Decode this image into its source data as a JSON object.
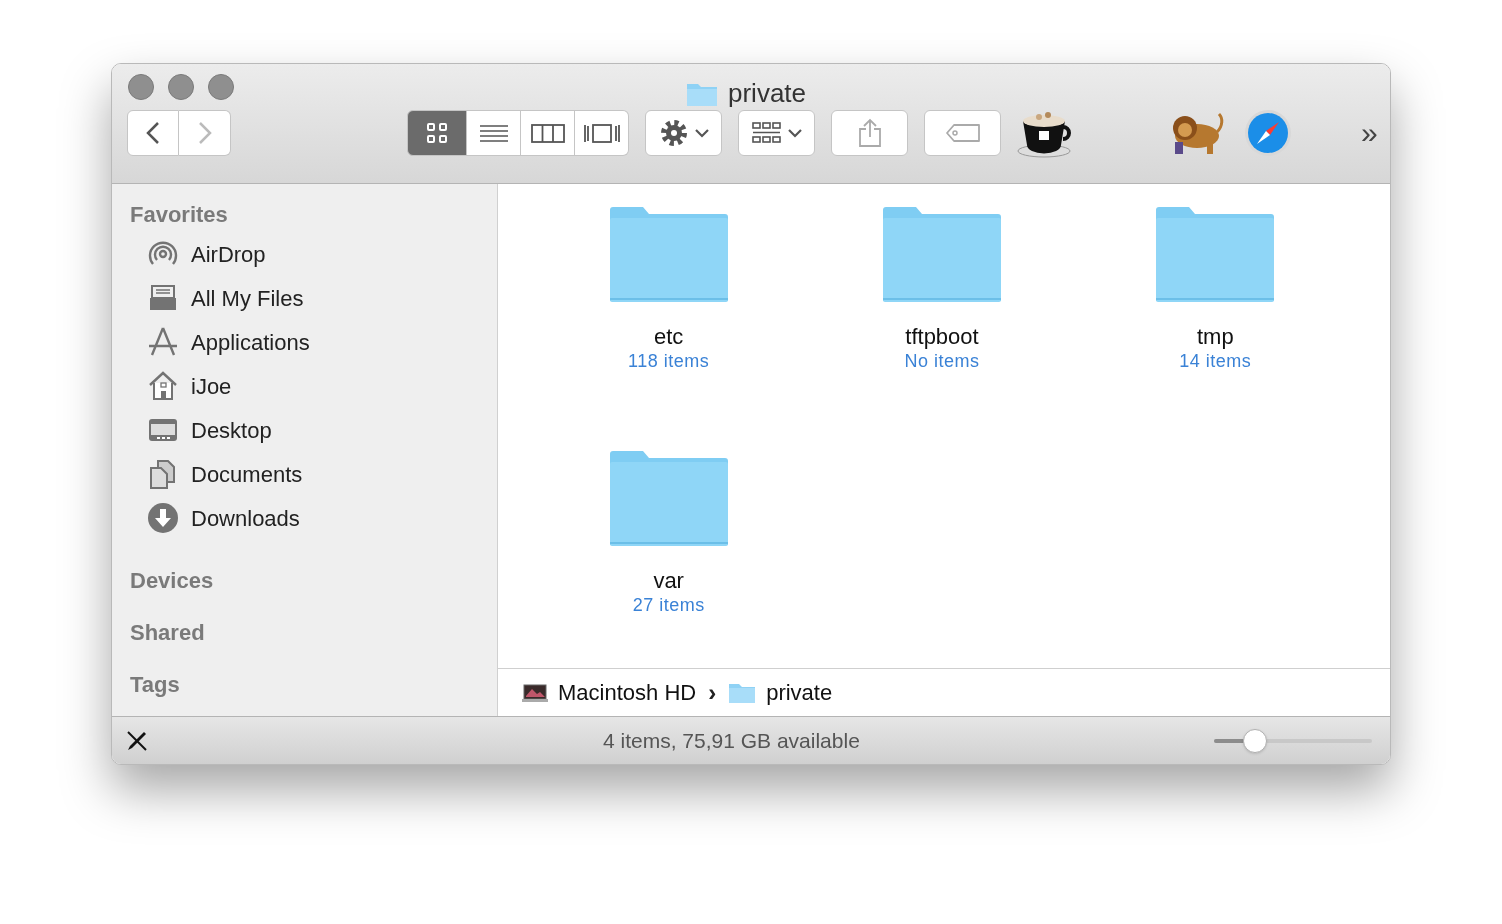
{
  "window": {
    "title": "private"
  },
  "view_modes": [
    {
      "kind": "icon",
      "selected": true
    },
    {
      "kind": "list",
      "selected": false
    },
    {
      "kind": "columns",
      "selected": false
    },
    {
      "kind": "coverflow",
      "selected": false
    }
  ],
  "overflow_button": "»",
  "sidebar": {
    "sections": [
      {
        "title": "Favorites",
        "items": [
          {
            "label": "AirDrop",
            "kind": "airdrop"
          },
          {
            "label": "All My Files",
            "kind": "files"
          },
          {
            "label": "Applications",
            "kind": "apps"
          },
          {
            "label": "iJoe",
            "kind": "home"
          },
          {
            "label": "Desktop",
            "kind": "desktop"
          },
          {
            "label": "Documents",
            "kind": "documents"
          },
          {
            "label": "Downloads",
            "kind": "downloads"
          }
        ]
      },
      {
        "title": "Devices"
      },
      {
        "title": "Shared"
      },
      {
        "title": "Tags"
      }
    ]
  },
  "folders": [
    {
      "name": "etc",
      "count": "118 items"
    },
    {
      "name": "tftpboot",
      "count": "No items"
    },
    {
      "name": "tmp",
      "count": "14 items"
    },
    {
      "name": "var",
      "count": "27 items"
    }
  ],
  "path_bar": [
    {
      "label": "Macintosh HD",
      "kind": "disk"
    },
    {
      "label": "private",
      "kind": "folder"
    }
  ],
  "path_separator": "›",
  "status_bar": {
    "text": "4 items, 75,91 GB available",
    "icon_size": {
      "level": 0.26
    }
  }
}
